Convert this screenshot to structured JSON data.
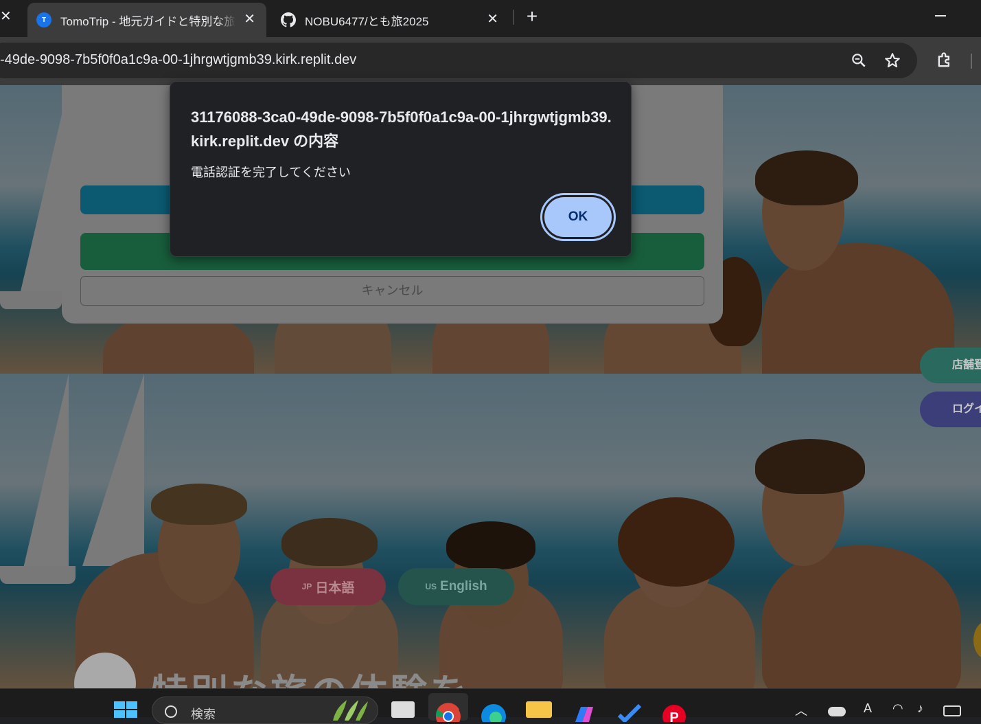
{
  "browser": {
    "tabs": [
      {
        "title": "TomoTrip - 地元ガイドと特別な旅",
        "favicon": "T",
        "active": true
      },
      {
        "title": "NOBU6477/とも旅2025",
        "favicon": "github-icon",
        "active": false
      }
    ],
    "url": "-49de-9098-7b5f0f0a1c9a-00-1jhrgwtjgmb39.kirk.replit.dev"
  },
  "alert": {
    "title": "31176088-3ca0-49de-9098-7b5f0f0a1c9a-00-1jhrgwtjgmb39.kirk.replit.dev の内容",
    "message": "電話認証を完了してください",
    "ok_label": "OK"
  },
  "modal": {
    "cancel_label": "キャンセル"
  },
  "page": {
    "side_buttons": {
      "store": "店舗登",
      "login": "ログイ"
    },
    "languages": [
      {
        "flag": "JP",
        "label": "日本語"
      },
      {
        "flag": "US",
        "label": "English"
      }
    ],
    "hero_title": "特別な旅の体験を"
  },
  "taskbar": {
    "search_placeholder": "検索",
    "ime_indicator": "A"
  },
  "colors": {
    "dialog_bg": "#202124",
    "ok_button": "#a8c7fa",
    "accent_blue": "#1a73e8"
  }
}
